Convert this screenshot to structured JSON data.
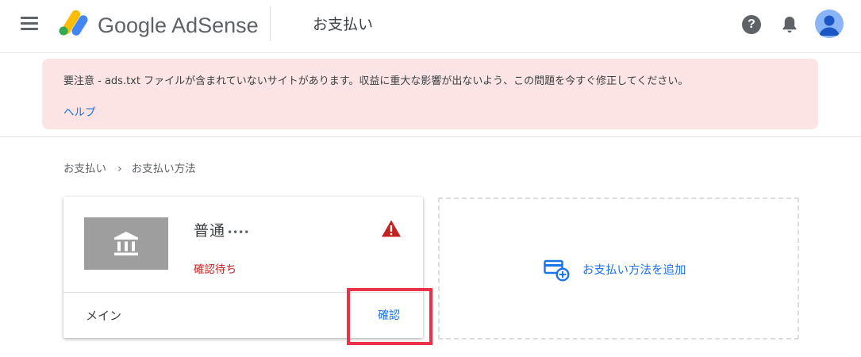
{
  "header": {
    "brand_google": "Google",
    "brand_product": "AdSense",
    "page_title": "お支払い",
    "help_glyph": "?"
  },
  "alert": {
    "message": "要注意 - ads.txt ファイルが含まれていないサイトがあります。収益に重大な影響が出ないよう、この問題を今すぐ修正してください。",
    "link": "ヘルプ"
  },
  "breadcrumb": {
    "items": [
      "お支払い",
      "お支払い方法"
    ],
    "separator": "›"
  },
  "payment_card": {
    "account_name": "普通",
    "account_mask": "••••",
    "status": "確認待ち",
    "label": "メイン",
    "action": "確認"
  },
  "add_payment": {
    "label": "お支払い方法を追加"
  },
  "colors": {
    "link": "#1a73e8",
    "alert_bg": "#fbe4e3",
    "warning": "#c5221f",
    "highlight": "#ea3349",
    "logo_yellow": "#fbbc04",
    "logo_blue": "#4285f4",
    "logo_green": "#34a853"
  },
  "icons": [
    "menu-icon",
    "adsense-logo-icon",
    "help-icon",
    "bell-icon",
    "avatar-icon",
    "bank-icon",
    "warning-icon",
    "add-payment-icon"
  ]
}
